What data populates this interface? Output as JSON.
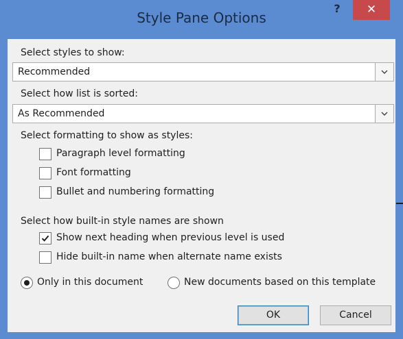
{
  "window": {
    "title": "Style Pane Options",
    "help_glyph": "?",
    "close_glyph": "✕"
  },
  "show_styles": {
    "label": "Select styles to show:",
    "value": "Recommended"
  },
  "sort": {
    "label": "Select how list is sorted:",
    "value": "As Recommended"
  },
  "formatting": {
    "label": "Select formatting to show as styles:",
    "paragraph": {
      "label": "Paragraph level formatting",
      "checked": false
    },
    "font": {
      "label": "Font formatting",
      "checked": false
    },
    "bullet": {
      "label": "Bullet and numbering formatting",
      "checked": false
    }
  },
  "builtin": {
    "label": "Select how built-in style names are shown",
    "next_heading": {
      "label": "Show next heading when previous level is used",
      "checked": true
    },
    "hide_builtin": {
      "label": "Hide built-in name when alternate name exists",
      "checked": false
    }
  },
  "scope": {
    "only_doc": {
      "label": "Only in this document",
      "selected": true
    },
    "new_docs": {
      "label": "New documents based on this template",
      "selected": false
    }
  },
  "buttons": {
    "ok": "OK",
    "cancel": "Cancel"
  },
  "colors": {
    "title_bar": "#5b8bd1",
    "close": "#c7494b",
    "client": "#f0f0f0"
  }
}
